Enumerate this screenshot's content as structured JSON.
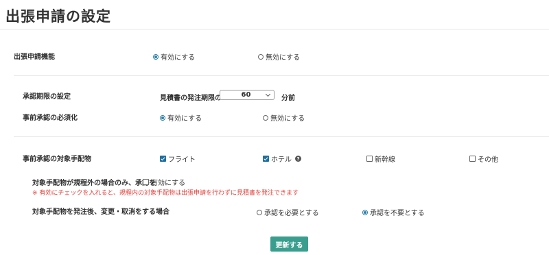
{
  "page": {
    "title": "出張申請の設定"
  },
  "settings": {
    "feature": {
      "label": "出張申請機能",
      "options": [
        "有効にする",
        "無効にする"
      ],
      "selected": "有効にする"
    },
    "approval_period": {
      "label": "承認期限の設定",
      "prefix": "見積書の発注期限の",
      "value": "60",
      "suffix": "分前"
    },
    "pre_approval_required": {
      "label": "事前承認の必須化",
      "options": [
        "有効にする",
        "無効にする"
      ],
      "selected": "有効にする"
    },
    "target_items": {
      "label": "事前承認の対象手配物",
      "items": [
        {
          "label": "フライト",
          "checked": true
        },
        {
          "label": "ホテル",
          "checked": true,
          "help_icon": "?"
        },
        {
          "label": "新幹線",
          "checked": false
        },
        {
          "label": "その他",
          "checked": false
        }
      ]
    },
    "out_of_policy": {
      "label": "対象手配物が規程外の場合のみ、承認を",
      "checkbox_label": "有効にする",
      "checked": false,
      "note": "※ 有効にチェックを入れると、規程内の対象手配物は出張申請を行わずに見積書を発注できます"
    },
    "change_cancel": {
      "label": "対象手配物を発注後、変更・取消をする場合",
      "options": [
        "承認を必要とする",
        "承認を不要とする"
      ],
      "selected": "承認を不要とする"
    }
  },
  "actions": {
    "update_label": "更新する"
  },
  "colors": {
    "accent": "#3a9e8f",
    "radio": "#2a7fa8",
    "note": "#e0403a"
  }
}
